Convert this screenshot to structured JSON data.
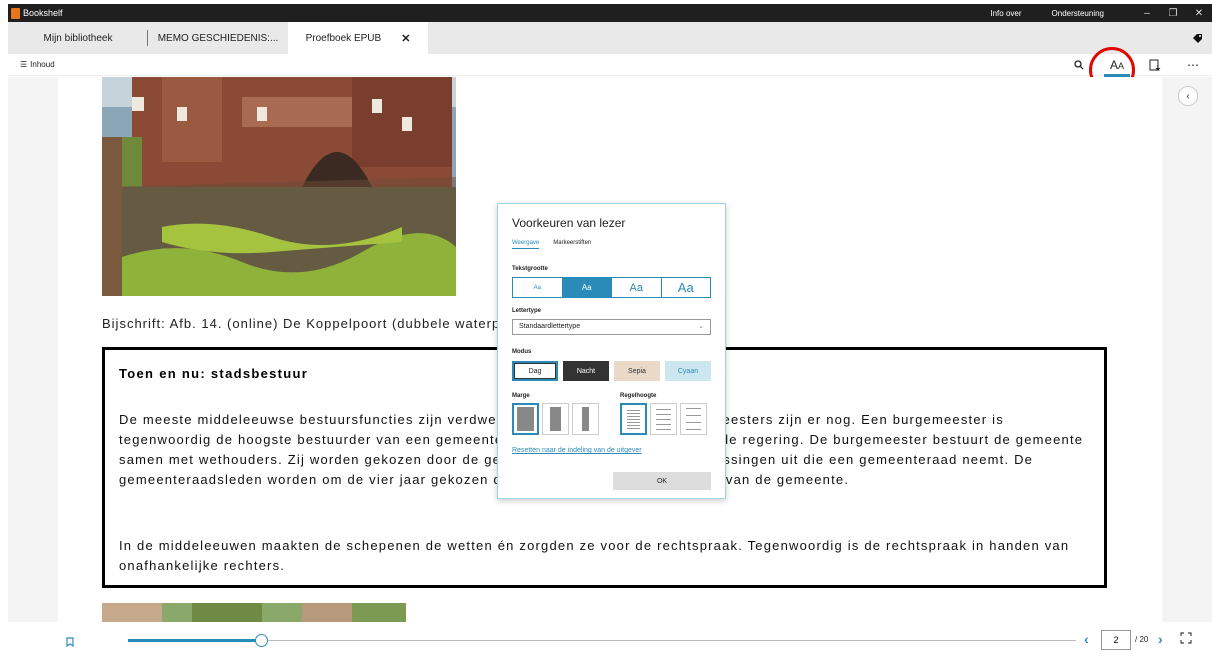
{
  "app": {
    "title": "Bookshelf"
  },
  "titlebar": {
    "links": [
      "Info over",
      "Ondersteuning"
    ]
  },
  "tabs": [
    {
      "label": "Mijn bibliotheek"
    },
    {
      "label": "MEMO GESCHIEDENIS:..."
    },
    {
      "label": "Proefboek EPUB"
    }
  ],
  "toolbar": {
    "toc_label": "Inhoud"
  },
  "content": {
    "caption": "Bijschrift: Afb. 14. (online) De Koppelpoort (dubbele waterpoort) in Amersfoort.",
    "box_title": "Toen en nu: stadsbestuur",
    "box_p1": "De meeste middeleeuwse bestuursfuncties zijn verdwenen of veranderd. Alleen burgemeesters zijn er nog. Een burgemeester is tegenwoordig de hoogste bestuurder van een gemeente. Hij of zij wordt benoemd door de regering. De burgemeester bestuurt de gemeente samen met wethouders. Zij worden gekozen door de gemeenteraad en voeren alle beslissingen uit die een gemeenteraad neemt. De gemeenteraadsleden worden om de vier jaar gekozen door alle meerderjarige inwoners van de gemeente.",
    "box_p2": "In de middeleeuwen maakten de schepenen de wetten én zorgden ze voor de rechtspraak. Tegenwoordig is de rechtspraak in handen van onafhankelijke rechters."
  },
  "dialog": {
    "title": "Voorkeuren van lezer",
    "tab_display": "Weergave",
    "tab_markers": "Markeerstiften",
    "text_size_label": "Tekstgrootte",
    "sizes": [
      "Aa",
      "Aa",
      "Aa",
      "Aa"
    ],
    "selected_size_index": 1,
    "font_label": "Lettertype",
    "font_value": "Standaardlettertype",
    "mode_label": "Modus",
    "modes": [
      "Dag",
      "Nacht",
      "Sepia",
      "Cyaan"
    ],
    "margin_label": "Marge",
    "line_height_label": "Regelhoogte",
    "reset_link": "Resetten naar de indeling van de uitgever",
    "ok": "OK"
  },
  "pagination": {
    "current": "2",
    "total": "/ 20"
  },
  "progress": {
    "fraction": 0.14
  },
  "colors": {
    "accent": "#2b8bb8",
    "highlight_circle": "#e10600"
  }
}
